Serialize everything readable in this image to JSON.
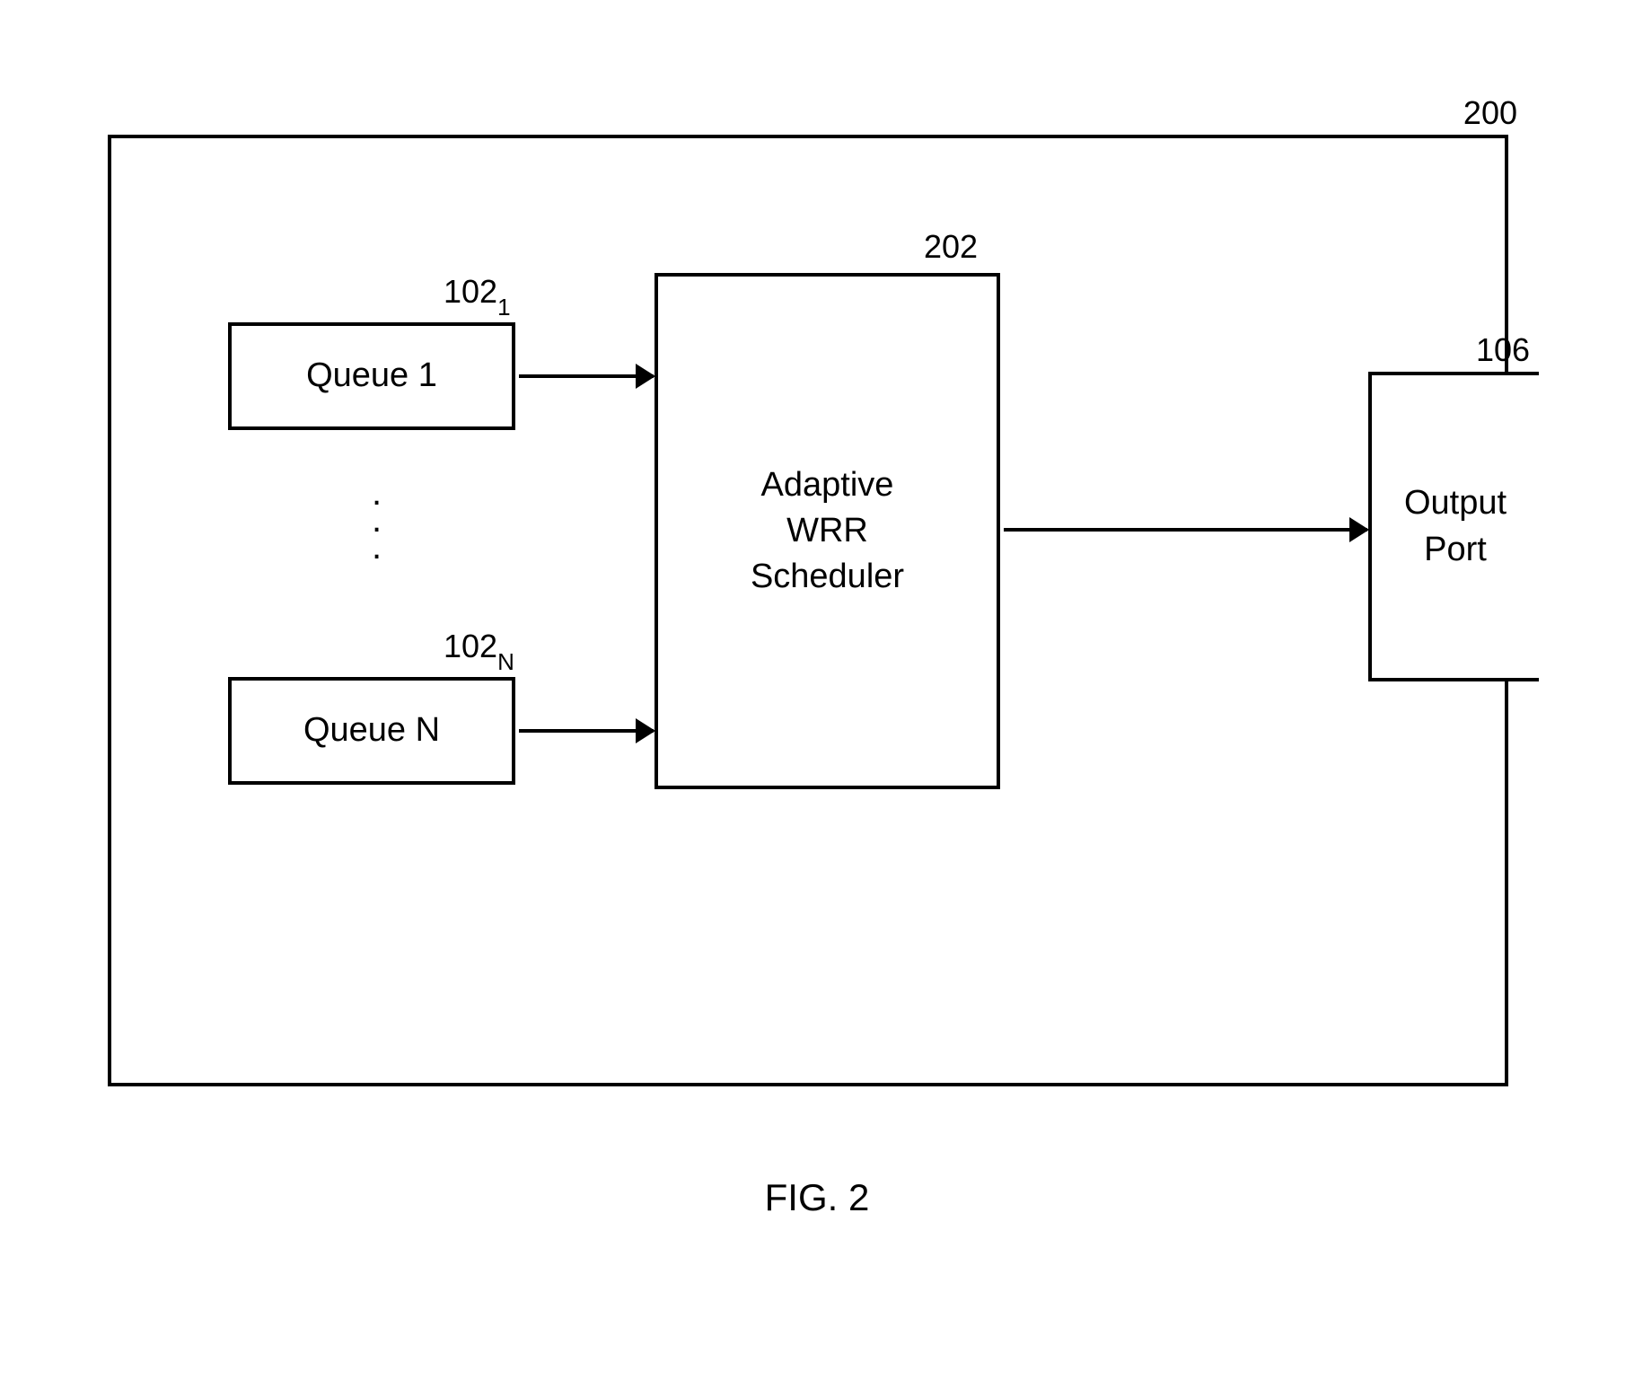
{
  "figure": {
    "number_top": "200",
    "caption": "FIG. 2",
    "blocks": {
      "queue1": {
        "label": "Queue 1",
        "ref_prefix": "102",
        "ref_sub": "1"
      },
      "queueN": {
        "label": "Queue N",
        "ref_prefix": "102",
        "ref_sub": "N"
      },
      "scheduler": {
        "label": "Adaptive\nWRR\nScheduler",
        "ref": "202"
      },
      "output": {
        "label": "Output\nPort",
        "ref": "106"
      }
    }
  }
}
